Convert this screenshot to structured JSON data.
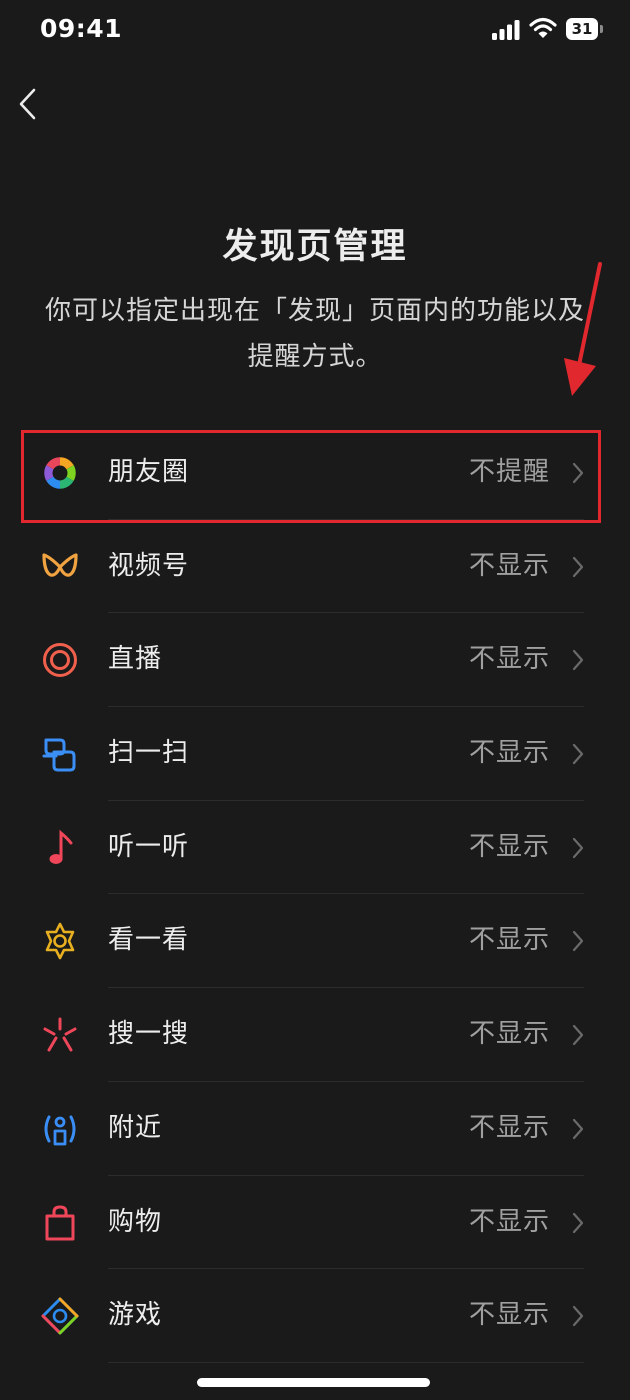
{
  "status_bar": {
    "time": "09:41",
    "battery": "31",
    "icons": [
      "signal-icon",
      "wifi-icon",
      "battery-icon"
    ]
  },
  "nav": {
    "back_icon": "chevron-left-icon"
  },
  "header": {
    "title": "发现页管理",
    "description": "你可以指定出现在「发现」页面内的功能以及提醒方式。"
  },
  "items": [
    {
      "label": "朋友圈",
      "status": "不提醒",
      "icon": "moments-icon"
    },
    {
      "label": "视频号",
      "status": "不显示",
      "icon": "channels-icon"
    },
    {
      "label": "直播",
      "status": "不显示",
      "icon": "live-icon"
    },
    {
      "label": "扫一扫",
      "status": "不显示",
      "icon": "scan-icon"
    },
    {
      "label": "听一听",
      "status": "不显示",
      "icon": "music-note-icon"
    },
    {
      "label": "看一看",
      "status": "不显示",
      "icon": "top-stories-icon"
    },
    {
      "label": "搜一搜",
      "status": "不显示",
      "icon": "search-icon"
    },
    {
      "label": "附近",
      "status": "不显示",
      "icon": "nearby-icon"
    },
    {
      "label": "购物",
      "status": "不显示",
      "icon": "shopping-bag-icon"
    },
    {
      "label": "游戏",
      "status": "不显示",
      "icon": "games-icon"
    }
  ],
  "colors": {
    "background": "#1a1a1a",
    "highlight": "#e0282e",
    "status_text": "#a0a0a0"
  }
}
